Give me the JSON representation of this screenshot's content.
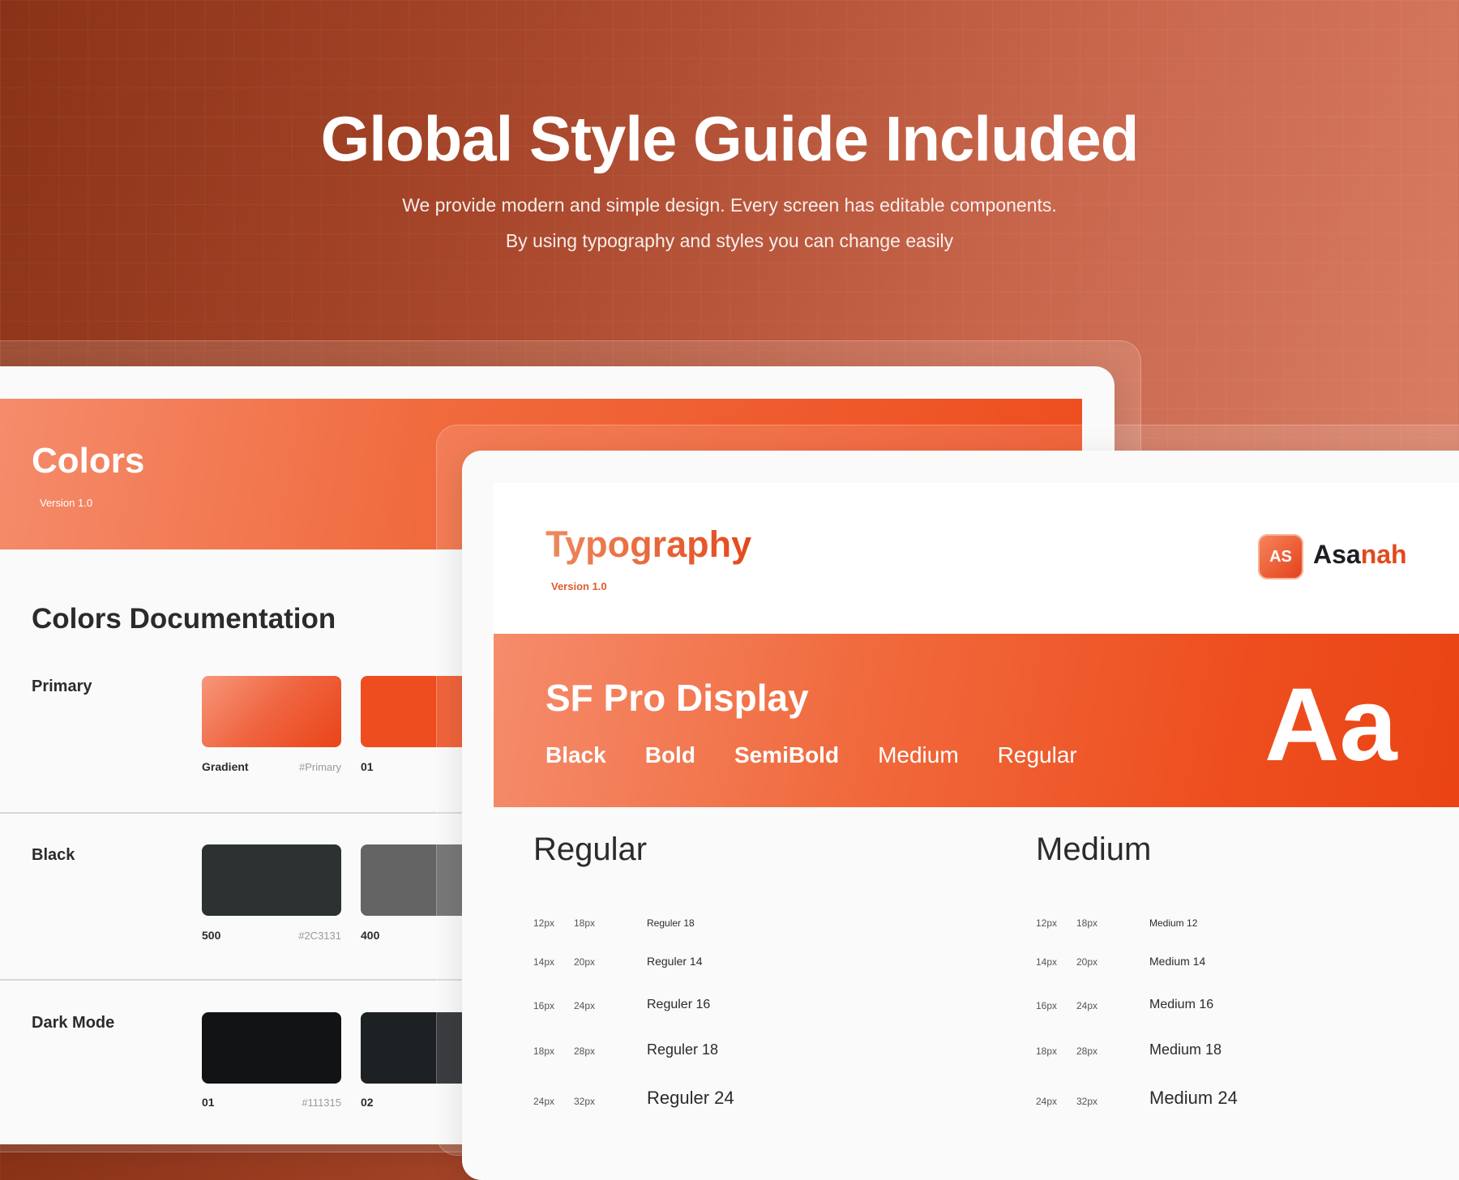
{
  "hero": {
    "title": "Global Style Guide Included",
    "subtitle_line1": "We provide modern and simple design. Every screen has editable components.",
    "subtitle_line2": "By using typography and styles you can change easily"
  },
  "colors": {
    "title": "Colors",
    "version": "Version 1.0",
    "doc_title": "Colors Documentation",
    "rows": [
      {
        "label": "Primary",
        "swatches": [
          {
            "name": "Gradient",
            "hex": "#Primary",
            "color": "gradient"
          },
          {
            "name": "01",
            "hex": "",
            "color": "#EE4E1F"
          }
        ]
      },
      {
        "label": "Black",
        "swatches": [
          {
            "name": "500",
            "hex": "#2C3131",
            "color": "#2C3131"
          },
          {
            "name": "400",
            "hex": "",
            "color": "#646464"
          }
        ]
      },
      {
        "label": "Dark Mode",
        "swatches": [
          {
            "name": "01",
            "hex": "#111315",
            "color": "#111315"
          },
          {
            "name": "02",
            "hex": "",
            "color": "#1E2124"
          }
        ]
      }
    ]
  },
  "typography": {
    "title": "Typography",
    "version": "Version 1.0",
    "logo_badge": "AS",
    "logo_text_prefix": "Asa",
    "logo_text_accent": "nah",
    "font_name": "SF Pro Display",
    "weights": [
      "Black",
      "Bold",
      "SemiBold",
      "Medium",
      "Regular"
    ],
    "sample": "Aa",
    "columns": [
      {
        "title": "Regular",
        "specs": [
          {
            "size": "12px",
            "line": "18px",
            "label": "Reguler 18"
          },
          {
            "size": "14px",
            "line": "20px",
            "label": "Reguler 14"
          },
          {
            "size": "16px",
            "line": "24px",
            "label": "Reguler 16"
          },
          {
            "size": "18px",
            "line": "28px",
            "label": "Reguler 18"
          },
          {
            "size": "24px",
            "line": "32px",
            "label": "Reguler 24"
          }
        ]
      },
      {
        "title": "Medium",
        "specs": [
          {
            "size": "12px",
            "line": "18px",
            "label": "Medium 12"
          },
          {
            "size": "14px",
            "line": "20px",
            "label": "Medium 14"
          },
          {
            "size": "16px",
            "line": "24px",
            "label": "Medium 16"
          },
          {
            "size": "18px",
            "line": "28px",
            "label": "Medium 18"
          },
          {
            "size": "24px",
            "line": "32px",
            "label": "Medium 24"
          }
        ]
      }
    ]
  }
}
